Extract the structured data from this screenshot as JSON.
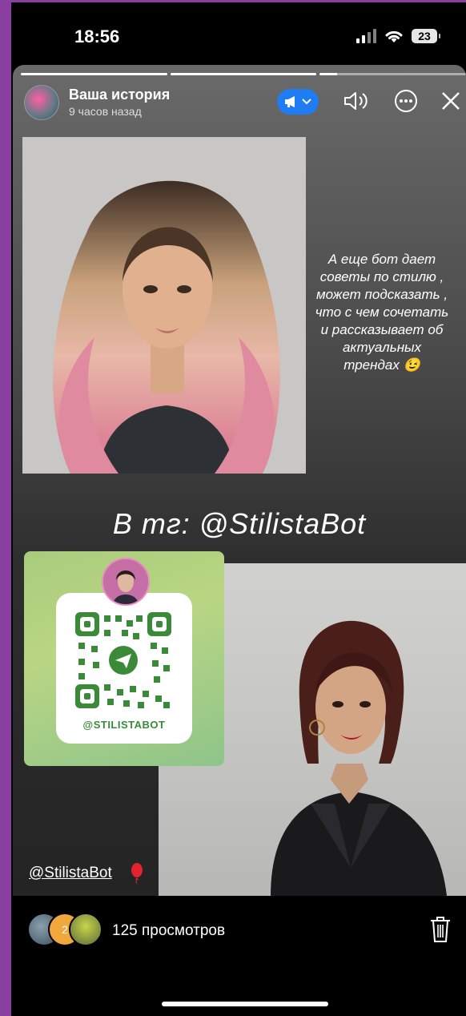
{
  "status": {
    "time": "18:56",
    "battery": "23"
  },
  "story": {
    "user": "Ваша история",
    "time": "9 часов назад",
    "caption": "А еще бот дает\nсоветы по стилю ,\nможет подсказать ,\nчто с чем сочетать\nи рассказывает об\nактуальных\nтрендах 😉",
    "bot_title": "В тг: @StilistaBot",
    "qr_label": "@STILISTABOT",
    "mention": "@StilistaBot"
  },
  "footer": {
    "views": "125  просмотров",
    "viewer_badge": "2"
  },
  "colors": {
    "accent_blue": "#1f7cf2",
    "qr_green": "#3b8a3a"
  }
}
